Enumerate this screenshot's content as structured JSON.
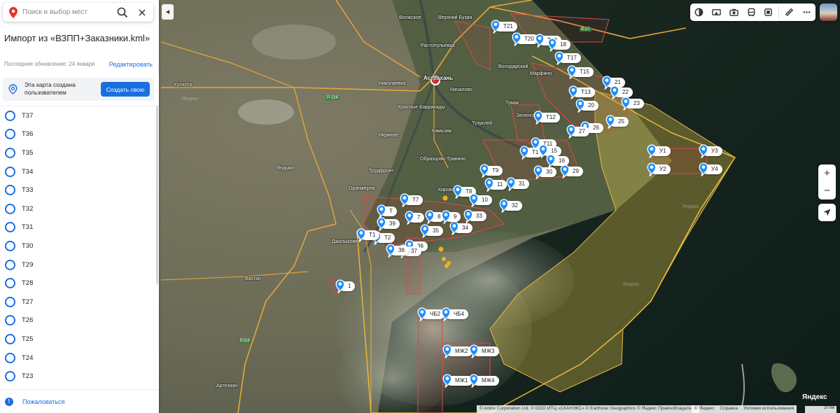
{
  "search": {
    "placeholder": "Поиск и выбор мест"
  },
  "doc": {
    "title": "Импорт из «ВЗПП+Заказники.kml»",
    "updated": "Последнее обновление: 24 января",
    "edit_label": "Редактировать",
    "created_text": "Эта карта создана пользователем",
    "create_label": "Создать свою"
  },
  "list": [
    "Т37",
    "Т36",
    "Т35",
    "Т34",
    "Т33",
    "Т32",
    "Т31",
    "Т30",
    "Т29",
    "Т28",
    "Т27",
    "Т26",
    "Т25",
    "Т24",
    "Т23"
  ],
  "report_label": "Пожаловаться",
  "map": {
    "places": [
      "Волжское",
      "Верхний Бузан",
      "Растопульевка",
      "Астрахань",
      "Началово",
      "Николаевка",
      "Красные Баррикады",
      "Икряное",
      "Тузуклей",
      "Камызяк",
      "Образцово-Травино",
      "Трудфронт",
      "Оранжереи",
      "Кировский",
      "Володарский",
      "Марфино",
      "Тумак",
      "Зеленга",
      "Хулхута",
      "Яндыки",
      "Джалыкове",
      "Вахтан",
      "Артезиан"
    ],
    "road_labels": [
      "Р-216",
      "А-27",
      "Е119"
    ],
    "markers": [
      "Т21",
      "Т20",
      "Т19",
      "18",
      "Т17",
      "Т15",
      "21",
      "Т13",
      "22",
      "23",
      "20",
      "Т12",
      "25",
      "26",
      "27",
      "Т11",
      "Т1",
      "15",
      "16",
      "30",
      "29",
      "Т9",
      "11",
      "31",
      "Т8",
      "10",
      "32",
      "33",
      "34",
      "35",
      "36",
      "37",
      "38",
      "39",
      "Т7",
      "Т",
      "Т2",
      "Т1",
      "7",
      "8",
      "9",
      "1",
      "ЧБ2",
      "ЧБ4",
      "МЖ2",
      "МЖ3",
      "МЖ1",
      "МЖ4",
      "У1",
      "У3",
      "У2",
      "У4"
    ],
    "watermark": "Яндекс",
    "attribution": "© Antrix Corporation Ltd. © ООО ИТЦ «СКАНЭКС» © Earthstar Geographics © Яндекс  Правообладатели",
    "attribution2": [
      "© Яндекс",
      "Справка",
      "Условия использования"
    ],
    "logo": "Яндекс",
    "scale_label": "20 км"
  },
  "colors": {
    "accent": "#1a6fe0",
    "marker": "#1e8fff",
    "route": "#e8a53a",
    "zone_border": "#d84a4a"
  }
}
